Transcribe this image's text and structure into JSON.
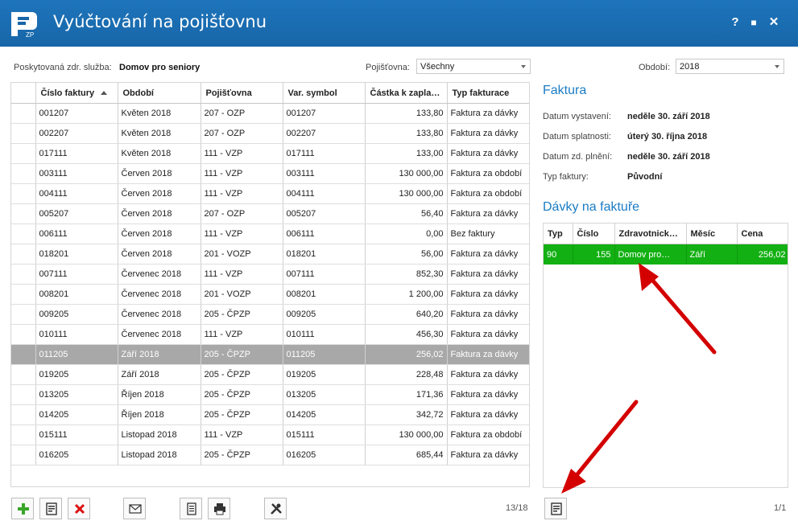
{
  "window": {
    "title": "Vyúčtování na pojišťovnu",
    "logo_text": "ZP",
    "help_label": "?",
    "maximize_label": "■",
    "close_label": "✕"
  },
  "filters": {
    "service_label": "Poskytovaná zdr. služba:",
    "service_value": "Domov pro seniory",
    "insurer_label": "Pojišťovna:",
    "insurer_value": "Všechny",
    "period_label": "Období:",
    "period_value": "2018"
  },
  "invoices": {
    "columns": [
      "Číslo faktury",
      "Období",
      "Pojišťovna",
      "Var. symbol",
      "Částka k zapla…",
      "Typ fakturace"
    ],
    "sorted_column": "Číslo faktury",
    "selected_row": 12,
    "rows": [
      [
        "001207",
        "Květen 2018",
        "207 - OZP",
        "001207",
        "133,80",
        "Faktura za dávky"
      ],
      [
        "002207",
        "Květen 2018",
        "207 - OZP",
        "002207",
        "133,80",
        "Faktura za dávky"
      ],
      [
        "017111",
        "Květen 2018",
        "111 - VZP",
        "017111",
        "133,00",
        "Faktura za dávky"
      ],
      [
        "003111",
        "Červen 2018",
        "111 - VZP",
        "003111",
        "130 000,00",
        "Faktura za období"
      ],
      [
        "004111",
        "Červen 2018",
        "111 - VZP",
        "004111",
        "130 000,00",
        "Faktura za období"
      ],
      [
        "005207",
        "Červen 2018",
        "207 - OZP",
        "005207",
        "56,40",
        "Faktura za dávky"
      ],
      [
        "006111",
        "Červen 2018",
        "111 - VZP",
        "006111",
        "0,00",
        "Bez faktury"
      ],
      [
        "018201",
        "Červen 2018",
        "201 - VOZP",
        "018201",
        "56,00",
        "Faktura za dávky"
      ],
      [
        "007111",
        "Červenec 2018",
        "111 - VZP",
        "007111",
        "852,30",
        "Faktura za dávky"
      ],
      [
        "008201",
        "Červenec 2018",
        "201 - VOZP",
        "008201",
        "1 200,00",
        "Faktura za dávky"
      ],
      [
        "009205",
        "Červenec 2018",
        "205 - ČPZP",
        "009205",
        "640,20",
        "Faktura za dávky"
      ],
      [
        "010111",
        "Červenec 2018",
        "111 - VZP",
        "010111",
        "456,30",
        "Faktura za dávky"
      ],
      [
        "011205",
        "Září 2018",
        "205 - ČPZP",
        "011205",
        "256,02",
        "Faktura za dávky"
      ],
      [
        "019205",
        "Září 2018",
        "205 - ČPZP",
        "019205",
        "228,48",
        "Faktura za dávky"
      ],
      [
        "013205",
        "Říjen 2018",
        "205 - ČPZP",
        "013205",
        "171,36",
        "Faktura za dávky"
      ],
      [
        "014205",
        "Říjen 2018",
        "205 - ČPZP",
        "014205",
        "342,72",
        "Faktura za dávky"
      ],
      [
        "015111",
        "Listopad 2018",
        "111 - VZP",
        "015111",
        "130 000,00",
        "Faktura za období"
      ],
      [
        "016205",
        "Listopad 2018",
        "205 - ČPZP",
        "016205",
        "685,44",
        "Faktura za dávky"
      ]
    ],
    "pager": "13/18"
  },
  "invoice_detail": {
    "title": "Faktura",
    "fields": [
      {
        "label": "Datum vystavení:",
        "value": "neděle 30. září 2018"
      },
      {
        "label": "Datum splatnosti:",
        "value": "úterý 30. října 2018"
      },
      {
        "label": "Datum zd. plnění:",
        "value": "neděle 30. září 2018"
      },
      {
        "label": "Typ faktury:",
        "value": "Původní"
      }
    ]
  },
  "batches": {
    "title": "Dávky na faktuře",
    "columns": [
      "Typ",
      "Číslo",
      "Zdravotnick…",
      "Měsíc",
      "Cena"
    ],
    "rows": [
      [
        "90",
        "155",
        "Domov pro…",
        "Září",
        "256,02"
      ]
    ],
    "pager": "1/1"
  },
  "toolbar": {
    "icons": [
      "add-icon",
      "edit-icon",
      "delete-icon",
      "send-mail-icon",
      "report-icon",
      "print-icon",
      "tools-icon"
    ],
    "batch_icons": [
      "edit-icon"
    ]
  },
  "colors": {
    "title_bar": "#1766a8",
    "accent_heading": "#1a7cc4",
    "selected_row": "#a8a8a8",
    "batch_row": "#12b012",
    "annotation_arrow": "#d40000"
  }
}
